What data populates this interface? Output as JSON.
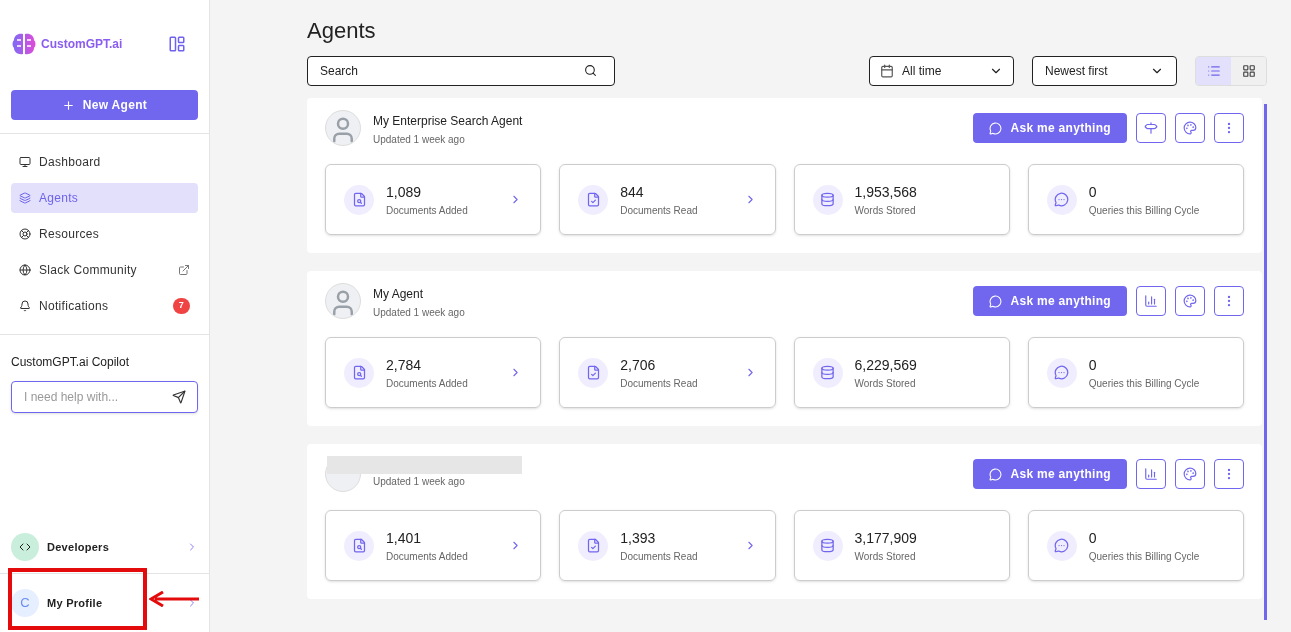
{
  "sidebar": {
    "logo": "CustomGPT.ai",
    "new_agent": "New Agent",
    "items": [
      {
        "label": "Dashboard",
        "kind": "dashboard",
        "selected": false
      },
      {
        "label": "Agents",
        "kind": "agents",
        "selected": true
      },
      {
        "label": "Resources",
        "kind": "resources",
        "selected": false
      },
      {
        "label": "Slack Community",
        "kind": "external",
        "selected": false
      },
      {
        "label": "Notifications",
        "kind": "notifications",
        "selected": false,
        "badge": "7"
      }
    ],
    "copilot": {
      "title": "CustomGPT.ai Copilot",
      "placeholder": "I need help with..."
    },
    "developers": "Developers",
    "profile": {
      "initial": "C",
      "label": "My Profile",
      "highlighted": true
    }
  },
  "page": {
    "title": "Agents",
    "search": {
      "placeholder": "Search"
    },
    "date_filter": "All time",
    "sort": "Newest first",
    "views": [
      {
        "kind": "list",
        "selected": true
      },
      {
        "kind": "grid",
        "selected": false
      }
    ]
  },
  "agents": [
    {
      "name": "My Enterprise Search Agent",
      "updated": "Updated 1 week ago",
      "kind": "deployed",
      "redacted": false,
      "ask": "Ask me anything",
      "stats": [
        {
          "kind": "added",
          "value": "1,089",
          "label": "Documents Added",
          "link": true
        },
        {
          "kind": "read",
          "value": "844",
          "label": "Documents Read",
          "link": true
        },
        {
          "kind": "words",
          "value": "1,953,568",
          "label": "Words Stored",
          "link": false
        },
        {
          "kind": "queries",
          "value": "0",
          "label": "Queries this Billing Cycle",
          "link": false
        }
      ]
    },
    {
      "name": "My Agent",
      "updated": "Updated 1 week ago",
      "kind": "standard",
      "redacted": false,
      "ask": "Ask me anything",
      "stats": [
        {
          "kind": "added",
          "value": "2,784",
          "label": "Documents Added",
          "link": true
        },
        {
          "kind": "read",
          "value": "2,706",
          "label": "Documents Read",
          "link": true
        },
        {
          "kind": "words",
          "value": "6,229,569",
          "label": "Words Stored",
          "link": false
        },
        {
          "kind": "queries",
          "value": "0",
          "label": "Queries this Billing Cycle",
          "link": false
        }
      ]
    },
    {
      "updated": "Updated 1 week ago",
      "kind": "standard",
      "redacted": true,
      "ask": "Ask me anything",
      "stats": [
        {
          "kind": "added",
          "value": "1,401",
          "label": "Documents Added",
          "link": true
        },
        {
          "kind": "read",
          "value": "1,393",
          "label": "Documents Read",
          "link": true
        },
        {
          "kind": "words",
          "value": "3,177,909",
          "label": "Words Stored",
          "link": false
        },
        {
          "kind": "queries",
          "value": "0",
          "label": "Queries this Billing Cycle",
          "link": false
        }
      ]
    }
  ]
}
